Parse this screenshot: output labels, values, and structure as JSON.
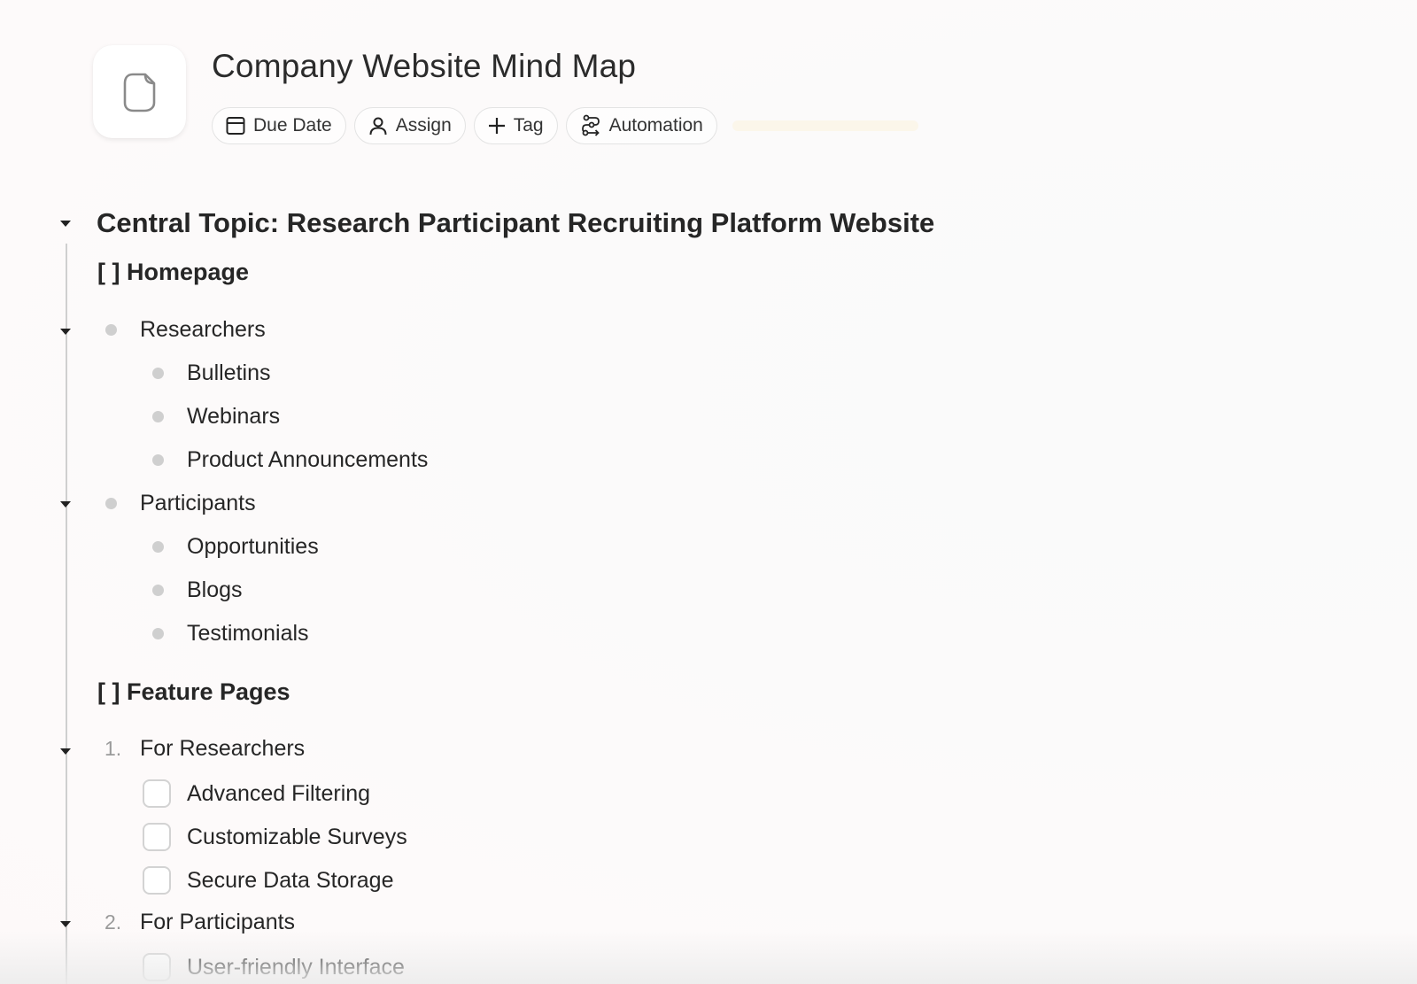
{
  "page": {
    "icon": "document-icon",
    "title": "Company Website Mind Map"
  },
  "toolbar": {
    "due_date": {
      "label": "Due Date",
      "icon": "calendar-icon"
    },
    "assign": {
      "label": "Assign",
      "icon": "user-icon"
    },
    "tag": {
      "label": "Tag",
      "icon": "plus-icon"
    },
    "automation": {
      "label": "Automation",
      "icon": "automation-icon"
    }
  },
  "outline": {
    "central_topic": "Central Topic: Research Participant Recruiting Platform Website",
    "homepage": {
      "heading": "[ ] Homepage",
      "groups": [
        {
          "label": "Researchers",
          "children": [
            "Bulletins",
            "Webinars",
            "Product Announcements"
          ]
        },
        {
          "label": "Participants",
          "children": [
            "Opportunities",
            "Blogs",
            "Testimonials"
          ]
        }
      ]
    },
    "feature_pages": {
      "heading": "[ ] Feature Pages",
      "groups": [
        {
          "number": "1.",
          "label": "For Researchers",
          "tasks": [
            {
              "label": "Advanced Filtering",
              "checked": false
            },
            {
              "label": "Customizable Surveys",
              "checked": false
            },
            {
              "label": "Secure Data Storage",
              "checked": false
            }
          ]
        },
        {
          "number": "2.",
          "label": "For Participants",
          "tasks": [
            {
              "label": "User-friendly Interface",
              "checked": false
            }
          ]
        }
      ]
    }
  },
  "colors": {
    "text": "#262626",
    "bullet": "#cfcfcf",
    "border": "#e3e3e3",
    "placeholder_bar": "#fbf6ea"
  }
}
